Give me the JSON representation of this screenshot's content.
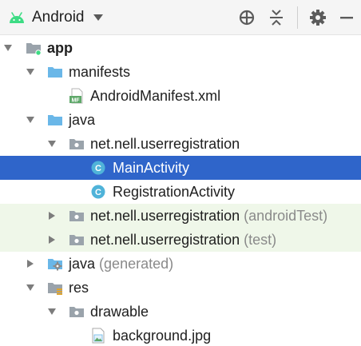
{
  "toolbar": {
    "view_label": "Android",
    "icons": {
      "view": "android-icon",
      "dropdown": "chevron-down-icon",
      "locate": "crosshair-icon",
      "collapse": "collapse-all-icon",
      "settings": "gear-icon",
      "hide": "minimize-icon"
    }
  },
  "tree": {
    "selected_index": 5,
    "rows": [
      {
        "label": "app",
        "suffix": "",
        "icon": "module-folder-icon",
        "expanded": true
      },
      {
        "label": "manifests",
        "suffix": "",
        "icon": "folder-icon",
        "expanded": true
      },
      {
        "label": "AndroidManifest.xml",
        "suffix": "",
        "icon": "manifest-file-icon"
      },
      {
        "label": "java",
        "suffix": "",
        "icon": "folder-icon",
        "expanded": true
      },
      {
        "label": "net.nell.userregistration",
        "suffix": "",
        "icon": "package-icon",
        "expanded": true
      },
      {
        "label": "MainActivity",
        "suffix": "",
        "icon": "class-icon"
      },
      {
        "label": "RegistrationActivity",
        "suffix": "",
        "icon": "class-icon"
      },
      {
        "label": "net.nell.userregistration",
        "suffix": "(androidTest)",
        "icon": "package-icon",
        "expanded": false
      },
      {
        "label": "net.nell.userregistration",
        "suffix": "(test)",
        "icon": "package-icon",
        "expanded": false
      },
      {
        "label": "java",
        "suffix": "(generated)",
        "icon": "generated-folder-icon",
        "expanded": false
      },
      {
        "label": "res",
        "suffix": "",
        "icon": "res-folder-icon",
        "expanded": true
      },
      {
        "label": "drawable",
        "suffix": "",
        "icon": "package-icon",
        "expanded": true
      },
      {
        "label": "background.jpg",
        "suffix": "",
        "icon": "image-file-icon"
      }
    ]
  },
  "colors": {
    "selection": "#2f65ca",
    "test_highlight": "#eff7e9",
    "folder": "#6ab7e8",
    "class_icon": "#4fb3d9",
    "android_green": "#3ddc84"
  }
}
